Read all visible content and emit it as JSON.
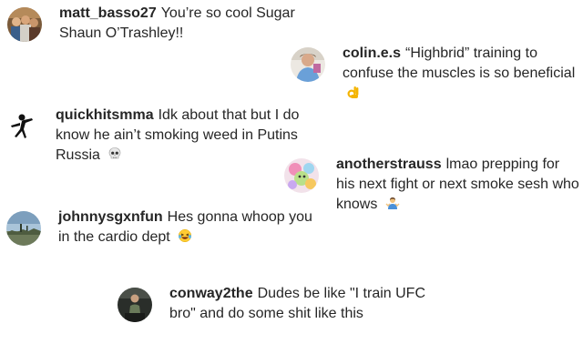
{
  "comments": [
    {
      "username": "matt_basso27",
      "text": "You’re so cool Sugar Shaun O’Trashley!!",
      "avatar_icon": "avatar-group-photo"
    },
    {
      "username": "colin.e.s",
      "text": "“Highbrid” training to confuse the muscles is so beneficial",
      "emoji": "ok-hand-emoji",
      "avatar_icon": "avatar-person-blue-shirt"
    },
    {
      "username": "quickhitsmma",
      "text": "Idk about that but I do know he ain’t smoking weed in Putins Russia",
      "emoji": "skull-emoji",
      "avatar_icon": "avatar-fighter-silhouette"
    },
    {
      "username": "anotherstrauss",
      "text": "lmao prepping for his next fight or next smoke sesh who knows",
      "emoji": "man-shrugging-emoji",
      "avatar_icon": "avatar-colorful-cartoon"
    },
    {
      "username": "johnnysgxnfun",
      "text": "Hes gonna whoop you in the cardio dept",
      "emoji": "laughing-tears-emoji",
      "avatar_icon": "avatar-landscape-sky"
    },
    {
      "username": "conway2the",
      "text": "Dudes be like \"I train UFC bro\" and do some shit like this",
      "avatar_icon": "avatar-dark-figure"
    }
  ],
  "colors": {
    "text": "#262626",
    "background": "#ffffff"
  }
}
